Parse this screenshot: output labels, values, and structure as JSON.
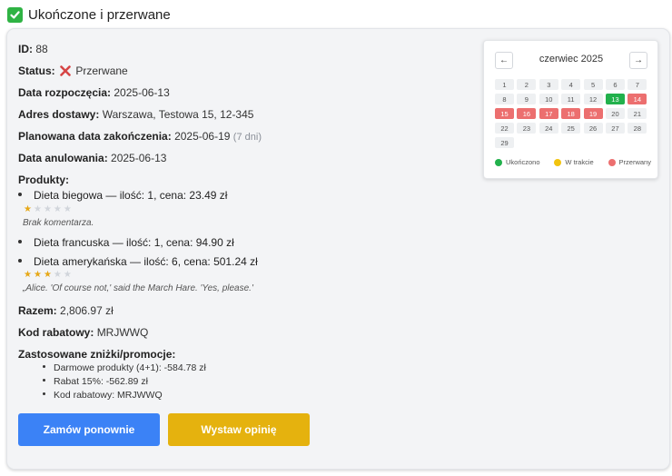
{
  "section": {
    "title": "Ukończone i przerwane"
  },
  "order": {
    "id_label": "ID:",
    "id_value": "88",
    "status_label": "Status:",
    "status_value": "Przerwane",
    "start_label": "Data rozpoczęcia:",
    "start_value": "2025-06-13",
    "address_label": "Adres dostawy:",
    "address_value": "Warszawa, Testowa 15, 12-345",
    "planned_label": "Planowana data zakończenia:",
    "planned_value": "2025-06-19",
    "planned_days": "(7 dni)",
    "cancel_label": "Data anulowania:",
    "cancel_value": "2025-06-13",
    "products_label": "Produkty:",
    "products": [
      {
        "text": "Dieta biegowa — ilość: 1, cena: 23.49 zł",
        "rating": 1,
        "comment": "Brak komentarza."
      },
      {
        "text": "Dieta francuska — ilość: 1, cena: 94.90 zł"
      },
      {
        "text": "Dieta amerykańska — ilość: 6, cena: 501.24 zł",
        "rating": 3,
        "comment": "„Alice. 'Of course not,' said the March Hare. 'Yes, please.'"
      }
    ],
    "total_label": "Razem:",
    "total_value": "2,806.97 zł",
    "code_label": "Kod rabatowy:",
    "code_value": "MRJWWQ",
    "discounts_label": "Zastosowane zniżki/promocje:",
    "discounts": [
      "Darmowe produkty (4+1): -584.78 zł",
      "Rabat 15%: -562.89 zł",
      "Kod rabatowy: MRJWWQ"
    ]
  },
  "buttons": {
    "reorder": "Zamów ponownie",
    "review": "Wystaw opinię"
  },
  "calendar": {
    "title": "czerwiec 2025",
    "prev": "←",
    "next": "→",
    "days": [
      {
        "d": "1",
        "s": ""
      },
      {
        "d": "2",
        "s": ""
      },
      {
        "d": "3",
        "s": ""
      },
      {
        "d": "4",
        "s": ""
      },
      {
        "d": "5",
        "s": ""
      },
      {
        "d": "6",
        "s": ""
      },
      {
        "d": "7",
        "s": ""
      },
      {
        "d": "8",
        "s": ""
      },
      {
        "d": "9",
        "s": ""
      },
      {
        "d": "10",
        "s": ""
      },
      {
        "d": "11",
        "s": ""
      },
      {
        "d": "12",
        "s": ""
      },
      {
        "d": "13",
        "s": "completed"
      },
      {
        "d": "14",
        "s": "interrupted"
      },
      {
        "d": "15",
        "s": "interrupted"
      },
      {
        "d": "16",
        "s": "interrupted"
      },
      {
        "d": "17",
        "s": "interrupted"
      },
      {
        "d": "18",
        "s": "interrupted"
      },
      {
        "d": "19",
        "s": "interrupted"
      },
      {
        "d": "20",
        "s": ""
      },
      {
        "d": "21",
        "s": ""
      },
      {
        "d": "22",
        "s": ""
      },
      {
        "d": "23",
        "s": ""
      },
      {
        "d": "24",
        "s": ""
      },
      {
        "d": "25",
        "s": ""
      },
      {
        "d": "26",
        "s": ""
      },
      {
        "d": "27",
        "s": ""
      },
      {
        "d": "28",
        "s": ""
      },
      {
        "d": "29",
        "s": ""
      }
    ],
    "legend": [
      {
        "label": "Ukończono",
        "color": "#22b14c"
      },
      {
        "label": "W trakcie",
        "color": "#f2c40f"
      },
      {
        "label": "Przerwany",
        "color": "#ec6f6f"
      }
    ]
  },
  "colors": {
    "accent_blue": "#3b82f6",
    "accent_yellow": "#e5b20e",
    "completed": "#22b14c",
    "interrupted": "#ec6f6f"
  }
}
